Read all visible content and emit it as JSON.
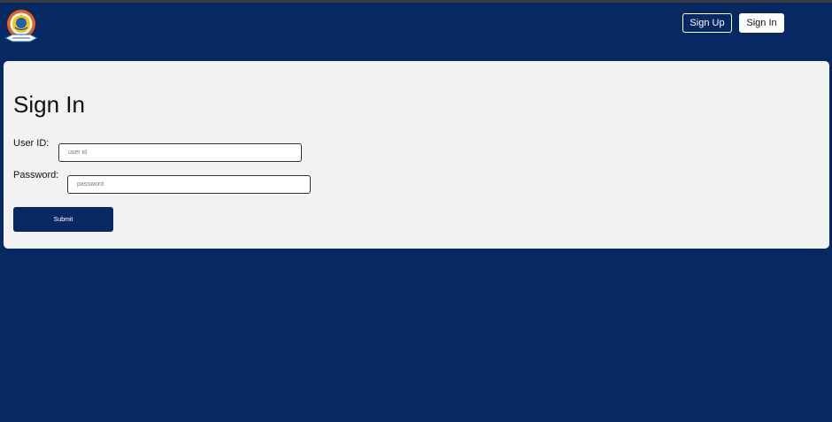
{
  "header": {
    "logo_icon": "institution-emblem-icon",
    "signup_label": "Sign Up",
    "signin_label": "Sign In"
  },
  "form": {
    "title": "Sign In",
    "user_id_label": "User ID:",
    "user_id_placeholder": "user id",
    "user_id_value": "",
    "password_label": "Password:",
    "password_placeholder": "password",
    "password_value": "",
    "submit_label": "Submit"
  },
  "colors": {
    "background": "#062863",
    "card": "#f2f2f2",
    "submit_button": "#062863",
    "emblem_orange": "#e8601c"
  }
}
